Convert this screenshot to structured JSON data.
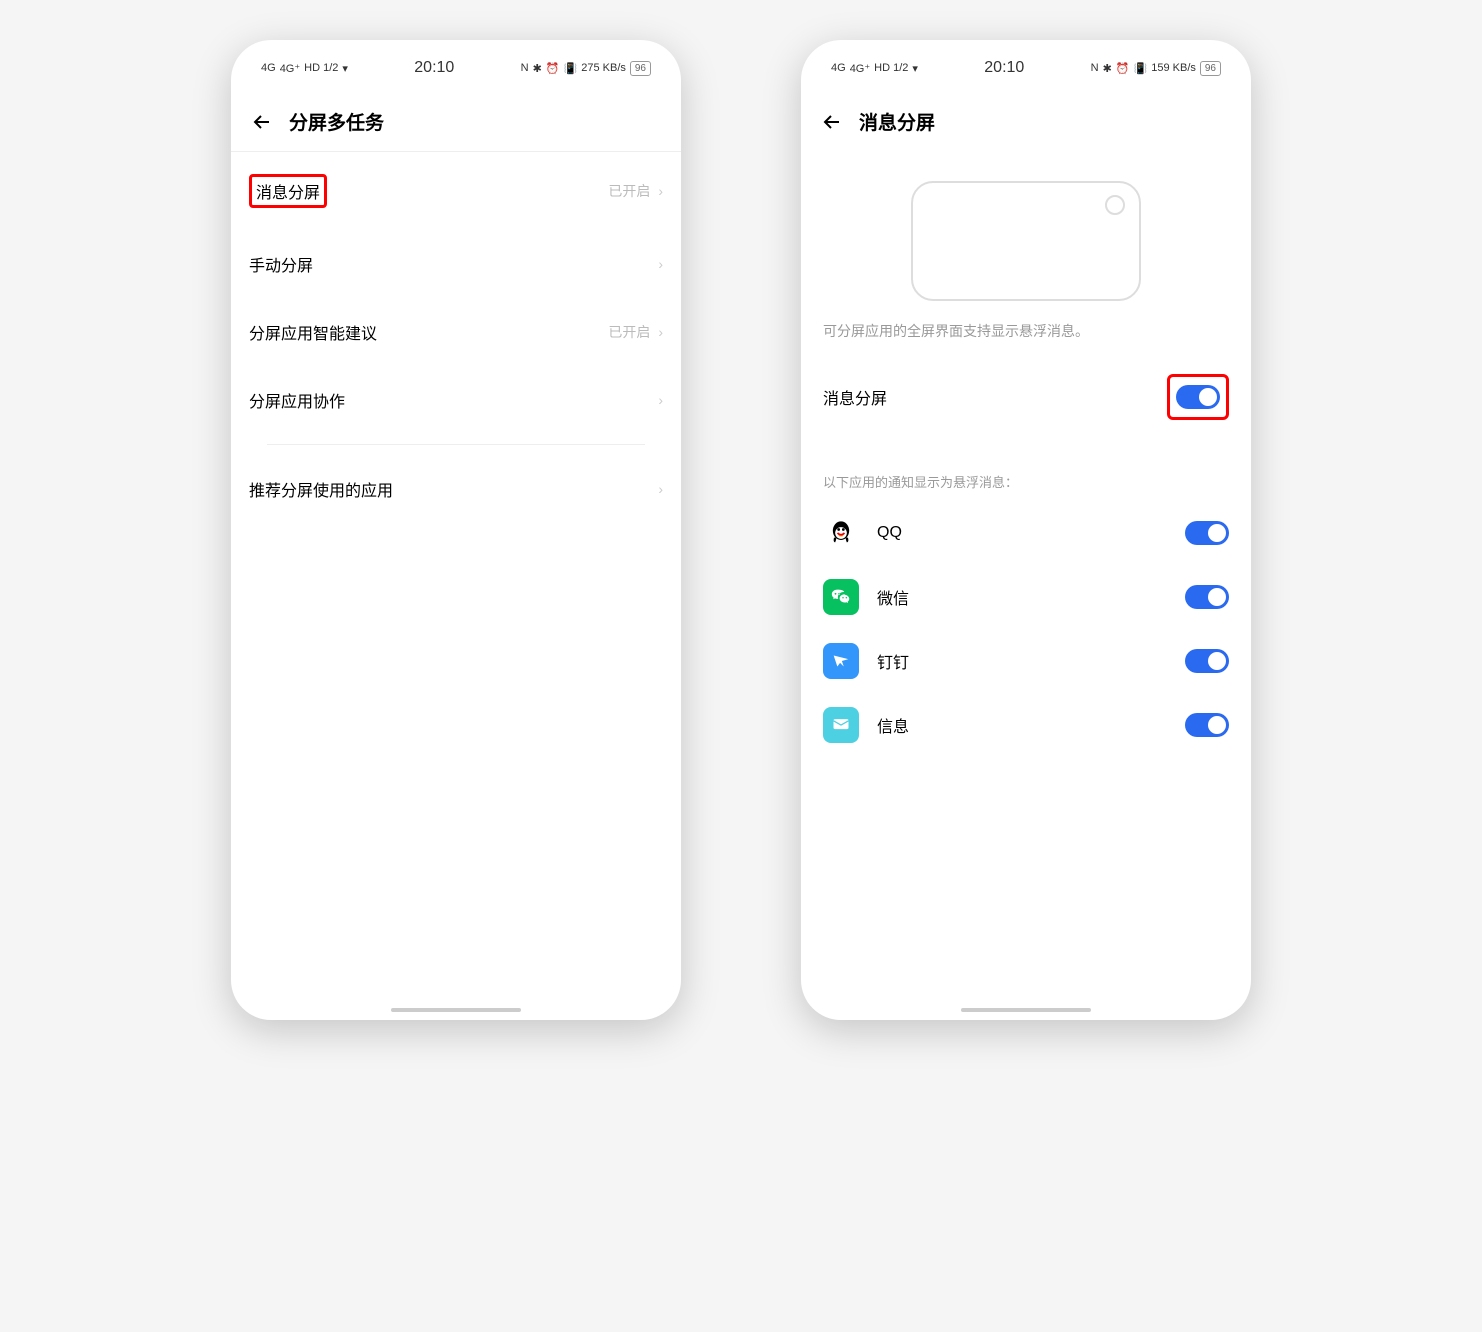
{
  "statusBar": {
    "signal1": "4G",
    "signal2": "4G⁺",
    "hd": "HD 1/2",
    "time": "20:10",
    "speedLeft": "275 KB/s",
    "speedRight": "159 KB/s",
    "battery": "96"
  },
  "left": {
    "title": "分屏多任务",
    "rows": [
      {
        "label": "消息分屏",
        "status": "已开启",
        "highlighted": true
      },
      {
        "label": "手动分屏",
        "status": ""
      },
      {
        "label": "分屏应用智能建议",
        "status": "已开启"
      },
      {
        "label": "分屏应用协作",
        "status": ""
      }
    ],
    "recommended": "推荐分屏使用的应用"
  },
  "right": {
    "title": "消息分屏",
    "description": "可分屏应用的全屏界面支持显示悬浮消息。",
    "mainToggle": {
      "label": "消息分屏",
      "on": true,
      "highlighted": true
    },
    "sectionLabel": "以下应用的通知显示为悬浮消息：",
    "apps": [
      {
        "name": "QQ",
        "icon": "qq",
        "on": true
      },
      {
        "name": "微信",
        "icon": "wechat",
        "on": true
      },
      {
        "name": "钉钉",
        "icon": "dingtalk",
        "on": true
      },
      {
        "name": "信息",
        "icon": "message",
        "on": true
      }
    ]
  }
}
